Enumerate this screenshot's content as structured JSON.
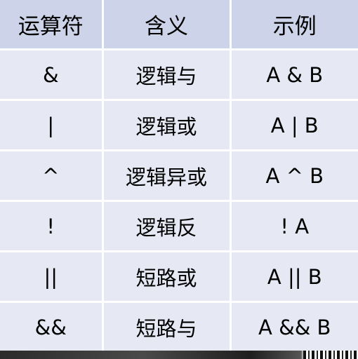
{
  "table": {
    "headers": [
      "运算符",
      "含义",
      "示例"
    ],
    "rows": [
      {
        "operator": "&",
        "meaning": "逻辑与",
        "example": "A & B"
      },
      {
        "operator": "|",
        "meaning": "逻辑或",
        "example": "A | B"
      },
      {
        "operator": "^",
        "meaning": "逻辑异或",
        "example": "A ^ B"
      },
      {
        "operator": "!",
        "meaning": "逻辑反",
        "example": "! A"
      },
      {
        "operator": "||",
        "meaning": "短路或",
        "example": "A || B"
      },
      {
        "operator": "&&",
        "meaning": "短路与",
        "example": "A && B"
      }
    ]
  },
  "colors": {
    "header_bg": "#cdd3e8",
    "row_bg": "#e6e9f4",
    "grid_line": "#ffffff"
  }
}
